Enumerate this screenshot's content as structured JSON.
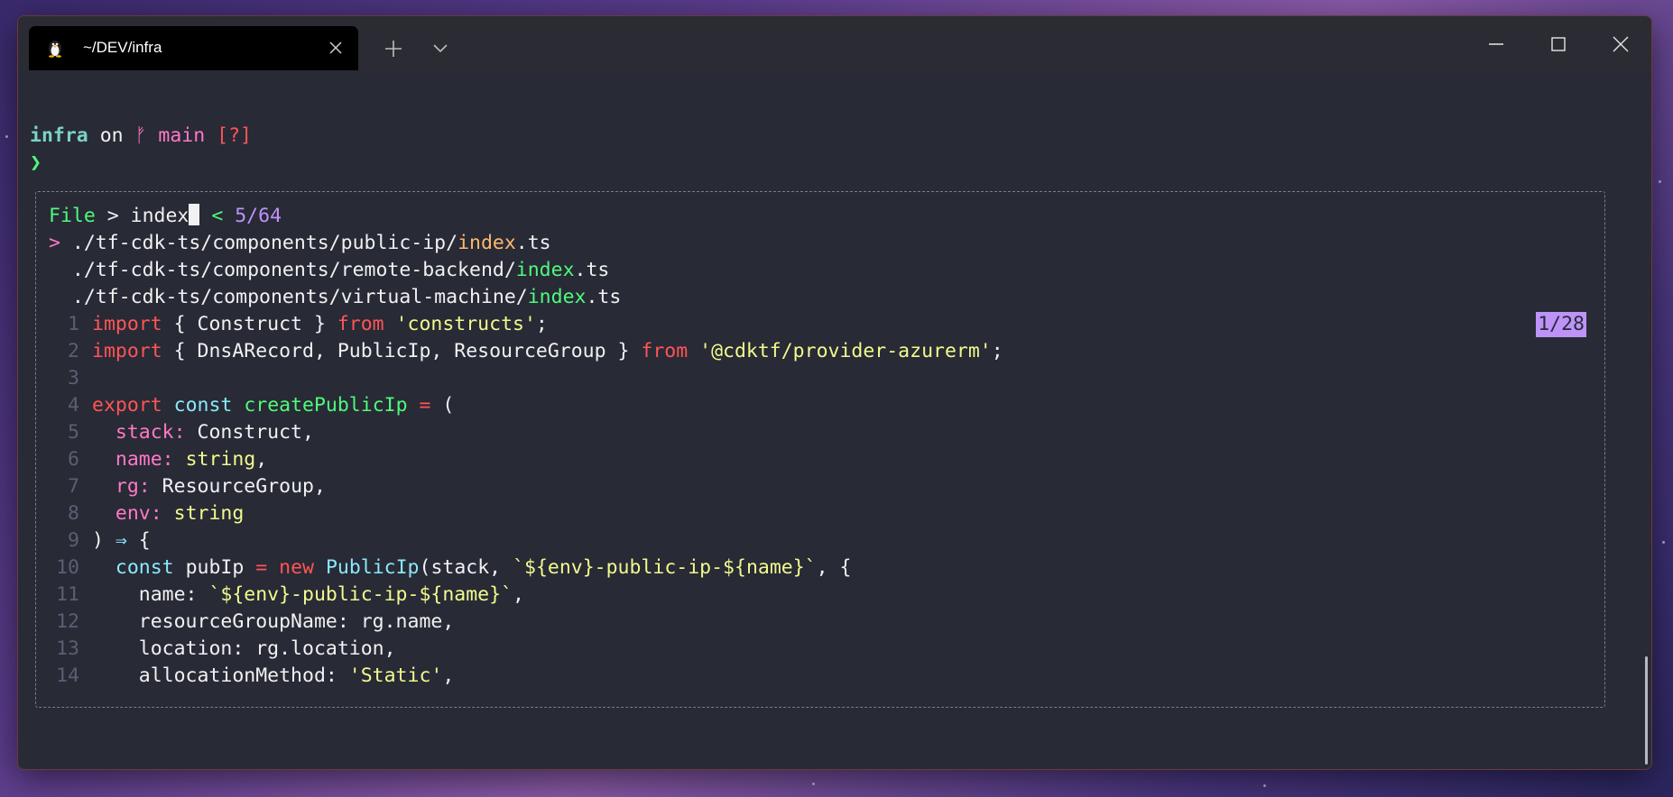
{
  "window": {
    "tab_title": "~/DEV/infra",
    "tab_icon": "linux-penguin-icon"
  },
  "prompt": {
    "dir": "infra",
    "on": "on",
    "branch_icon": "git-branch-icon",
    "branch": "main",
    "status": "[?]",
    "arrow": "❯"
  },
  "fzf": {
    "label": "File",
    "sep": ">",
    "query": "index",
    "back": "<",
    "count": "5/64",
    "results": [
      {
        "marker": ">",
        "prefix": "./tf-cdk-ts/components/public-ip/",
        "match": "index",
        "suffix": ".ts",
        "selected": true
      },
      {
        "marker": " ",
        "prefix": "./tf-cdk-ts/components/remote-backend/",
        "match": "index",
        "suffix": ".ts",
        "selected": false
      },
      {
        "marker": " ",
        "prefix": "./tf-cdk-ts/components/virtual-machine/",
        "match": "index",
        "suffix": ".ts",
        "selected": false
      }
    ],
    "preview_position": "1/28"
  },
  "code": {
    "l1": {
      "n": "1",
      "a": "import",
      "b": " { Construct } ",
      "c": "from",
      "d": " ",
      "e": "'constructs'",
      "f": ";"
    },
    "l2": {
      "n": "2",
      "a": "import",
      "b": " { DnsARecord, PublicIp, ResourceGroup } ",
      "c": "from",
      "d": " ",
      "e": "'@cdktf/provider-azurerm'",
      "f": ";"
    },
    "l3": {
      "n": "3"
    },
    "l4": {
      "n": "4",
      "a": "export",
      "b": " ",
      "c": "const",
      "d": " ",
      "e": "createPublicIp",
      "f": " ",
      "g": "=",
      "h": " ("
    },
    "l5": {
      "n": "5",
      "key": "stack:",
      "val": " Construct,"
    },
    "l6": {
      "n": "6",
      "key": "name:",
      "type": "string",
      "rest": ","
    },
    "l7": {
      "n": "7",
      "key": "rg:",
      "val": " ResourceGroup,"
    },
    "l8": {
      "n": "8",
      "key": "env:",
      "type": "string"
    },
    "l9": {
      "n": "9",
      "a": ") ",
      "arrow": "⇒",
      "b": " {"
    },
    "l10": {
      "n": "10",
      "a": "const",
      "b": " pubIp ",
      "c": "=",
      "d": " ",
      "e": "new",
      "f": " ",
      "g": "PublicIp",
      "h": "(stack, ",
      "i": "`${env}-public-ip-${name}`",
      "j": ", {"
    },
    "l11": {
      "n": "11",
      "a": "name: ",
      "b": "`${env}-public-ip-${name}`",
      "c": ","
    },
    "l12": {
      "n": "12",
      "a": "resourceGroupName: rg.name,"
    },
    "l13": {
      "n": "13",
      "a": "location: rg.location,"
    },
    "l14": {
      "n": "14",
      "a": "allocationMethod: ",
      "b": "'Static'",
      "c": ","
    }
  }
}
